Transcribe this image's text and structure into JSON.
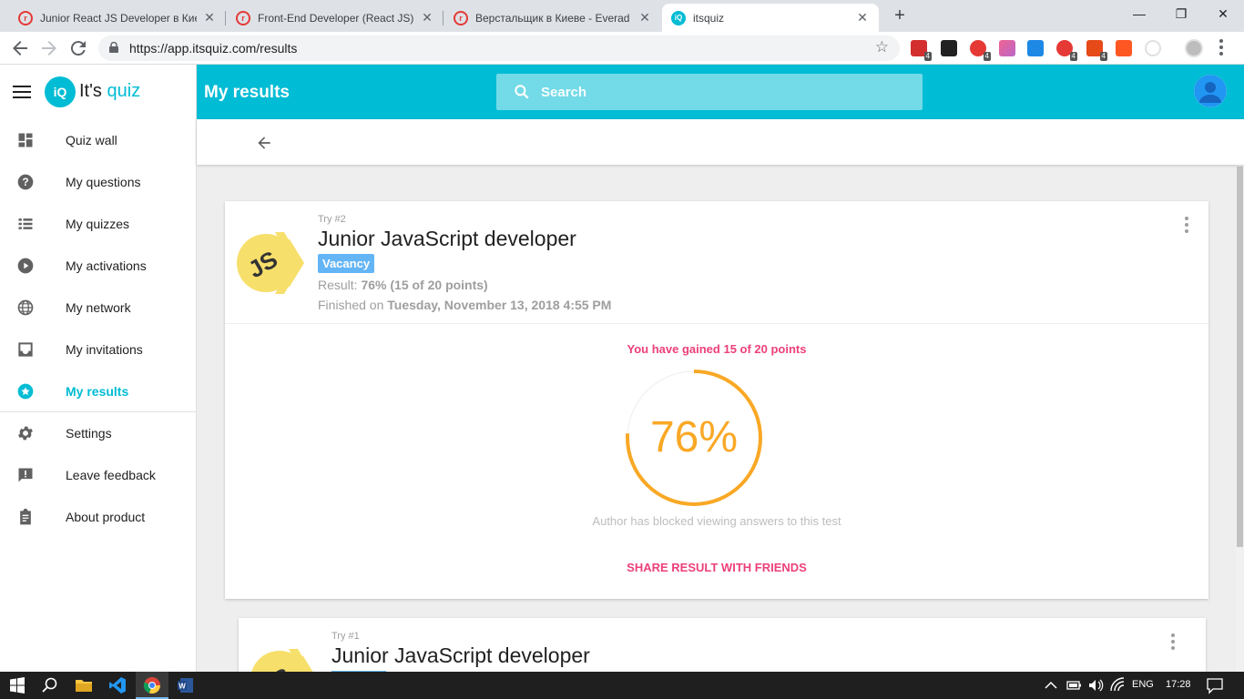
{
  "browser": {
    "tabs": [
      {
        "title": "Junior React JS Developer в Киев",
        "favicon": "rabota-icon"
      },
      {
        "title": "Front-End Developer (React JS) в",
        "favicon": "rabota-icon"
      },
      {
        "title": "Верстальщик в Киеве - Everad |",
        "favicon": "rabota-icon"
      },
      {
        "title": "itsquiz",
        "favicon": "itsquiz-icon"
      }
    ],
    "url": "https://app.itsquiz.com/results",
    "extension_badges": [
      "4",
      "4",
      "4",
      "4"
    ]
  },
  "sidebar": {
    "logo_mark": "iQ",
    "logo_text_1": "It's",
    "logo_text_2": "quiz",
    "items": [
      {
        "label": "Quiz wall",
        "icon": "dashboard-icon"
      },
      {
        "label": "My questions",
        "icon": "help-icon"
      },
      {
        "label": "My quizzes",
        "icon": "list-icon"
      },
      {
        "label": "My activations",
        "icon": "play-circle-icon"
      },
      {
        "label": "My network",
        "icon": "globe-icon"
      },
      {
        "label": "My invitations",
        "icon": "inbox-icon"
      },
      {
        "label": "My results",
        "icon": "star-circle-icon",
        "active": true
      },
      {
        "label": "Settings",
        "icon": "gear-icon"
      },
      {
        "label": "Leave feedback",
        "icon": "feedback-icon"
      },
      {
        "label": "About product",
        "icon": "clipboard-icon"
      }
    ]
  },
  "header": {
    "title": "My results",
    "search_placeholder": "Search"
  },
  "results": [
    {
      "try": "Try #2",
      "title": "Junior JavaScript developer",
      "badge": "Vacancy",
      "result_label": "Result:",
      "result_value": "76% (15 of 20 points)",
      "finished_label": "Finished on",
      "finished_value": "Tuesday, November 13, 2018 4:55 PM",
      "gained": "You have gained 15 of 20 points",
      "percent_text": "76%",
      "percent": 76,
      "blocked": "Author has blocked viewing answers to this test",
      "share": "SHARE RESULT WITH FRIENDS"
    },
    {
      "try": "Try #1",
      "title": "Junior JavaScript developer"
    }
  ],
  "colors": {
    "accent": "#00bcd4",
    "ring": "#f9a825",
    "pink": "#ec407a",
    "badge": "#64b5f6"
  },
  "taskbar": {
    "lang": "ENG",
    "time": "17:28"
  }
}
